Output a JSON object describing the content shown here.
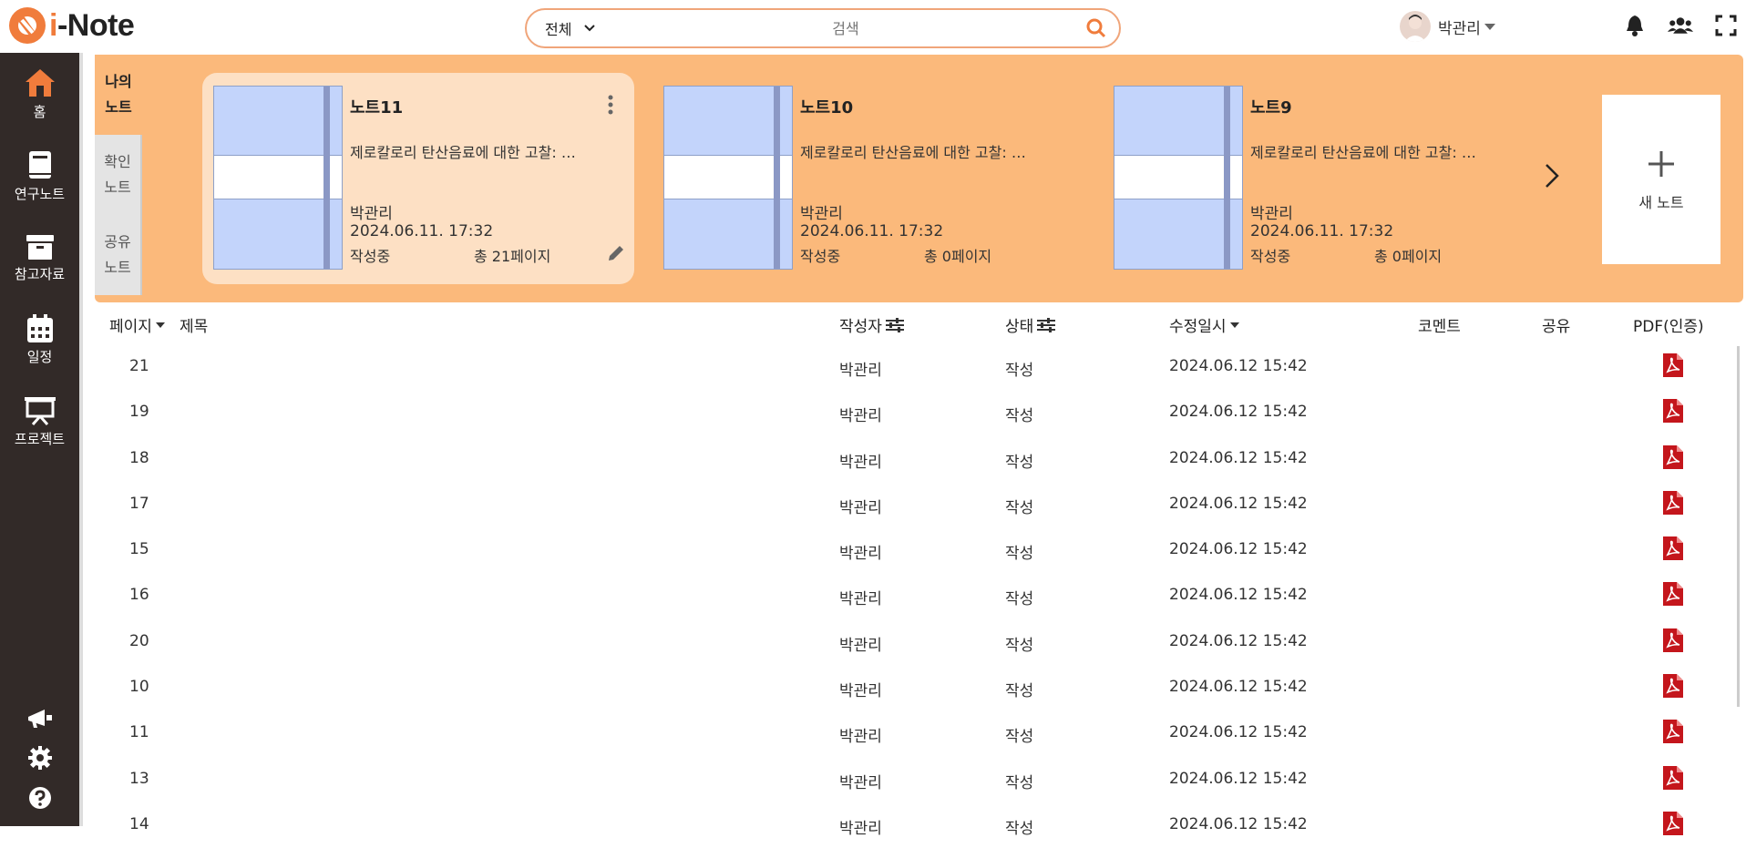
{
  "app": {
    "logo_text_accent": "i",
    "logo_text_rest": "-Note",
    "brand_color": "#f07c3c"
  },
  "search": {
    "scope_label": "전체",
    "placeholder": "검색"
  },
  "user": {
    "name": "박관리"
  },
  "top_icons": [
    "bell-icon",
    "users-icon",
    "fullscreen-icon"
  ],
  "sidebar": {
    "items": [
      {
        "label": "홈",
        "icon": "home-icon",
        "active": true
      },
      {
        "label": "연구노트",
        "icon": "notebook-icon"
      },
      {
        "label": "참고자료",
        "icon": "archive-icon"
      },
      {
        "label": "일정",
        "icon": "calendar-icon"
      },
      {
        "label": "프로젝트",
        "icon": "presentation-icon"
      }
    ],
    "bottom_icons": [
      "megaphone-icon",
      "settings-icon",
      "help-icon"
    ]
  },
  "banner": {
    "tabs": [
      {
        "label_line1": "나의",
        "label_line2": "노트"
      },
      {
        "label_line1": "확인",
        "label_line2": "노트"
      },
      {
        "label_line1": "공유",
        "label_line2": "노트"
      }
    ],
    "notes": [
      {
        "title": "노트11",
        "desc": "제로칼로리 탄산음료에 대한 고찰: …",
        "author": "박관리",
        "date": "2024.06.11. 17:32",
        "status": "작성중",
        "pages": "총 21페이지"
      },
      {
        "title": "노트10",
        "desc": "제로칼로리 탄산음료에 대한 고찰: …",
        "author": "박관리",
        "date": "2024.06.11. 17:32",
        "status": "작성중",
        "pages": "총 0페이지"
      },
      {
        "title": "노트9",
        "desc": "제로칼로리 탄산음료에 대한 고찰: …",
        "author": "박관리",
        "date": "2024.06.11. 17:32",
        "status": "작성중",
        "pages": "총 0페이지"
      }
    ],
    "new_note_label": "새 노트"
  },
  "table": {
    "headers": {
      "page": "페이지",
      "title": "제목",
      "author": "작성자",
      "status": "상태",
      "modified": "수정일시",
      "comment": "코멘트",
      "share": "공유",
      "pdf": "PDF(인증)"
    },
    "rows": [
      {
        "page": "21",
        "author": "박관리",
        "status": "작성",
        "modified": "2024.06.12 15:42"
      },
      {
        "page": "19",
        "author": "박관리",
        "status": "작성",
        "modified": "2024.06.12 15:42"
      },
      {
        "page": "18",
        "author": "박관리",
        "status": "작성",
        "modified": "2024.06.12 15:42"
      },
      {
        "page": "17",
        "author": "박관리",
        "status": "작성",
        "modified": "2024.06.12 15:42"
      },
      {
        "page": "15",
        "author": "박관리",
        "status": "작성",
        "modified": "2024.06.12 15:42"
      },
      {
        "page": "16",
        "author": "박관리",
        "status": "작성",
        "modified": "2024.06.12 15:42"
      },
      {
        "page": "20",
        "author": "박관리",
        "status": "작성",
        "modified": "2024.06.12 15:42"
      },
      {
        "page": "10",
        "author": "박관리",
        "status": "작성",
        "modified": "2024.06.12 15:42"
      },
      {
        "page": "11",
        "author": "박관리",
        "status": "작성",
        "modified": "2024.06.12 15:42"
      },
      {
        "page": "13",
        "author": "박관리",
        "status": "작성",
        "modified": "2024.06.12 15:42"
      },
      {
        "page": "14",
        "author": "박관리",
        "status": "작성",
        "modified": "2024.06.12 15:42"
      }
    ]
  }
}
